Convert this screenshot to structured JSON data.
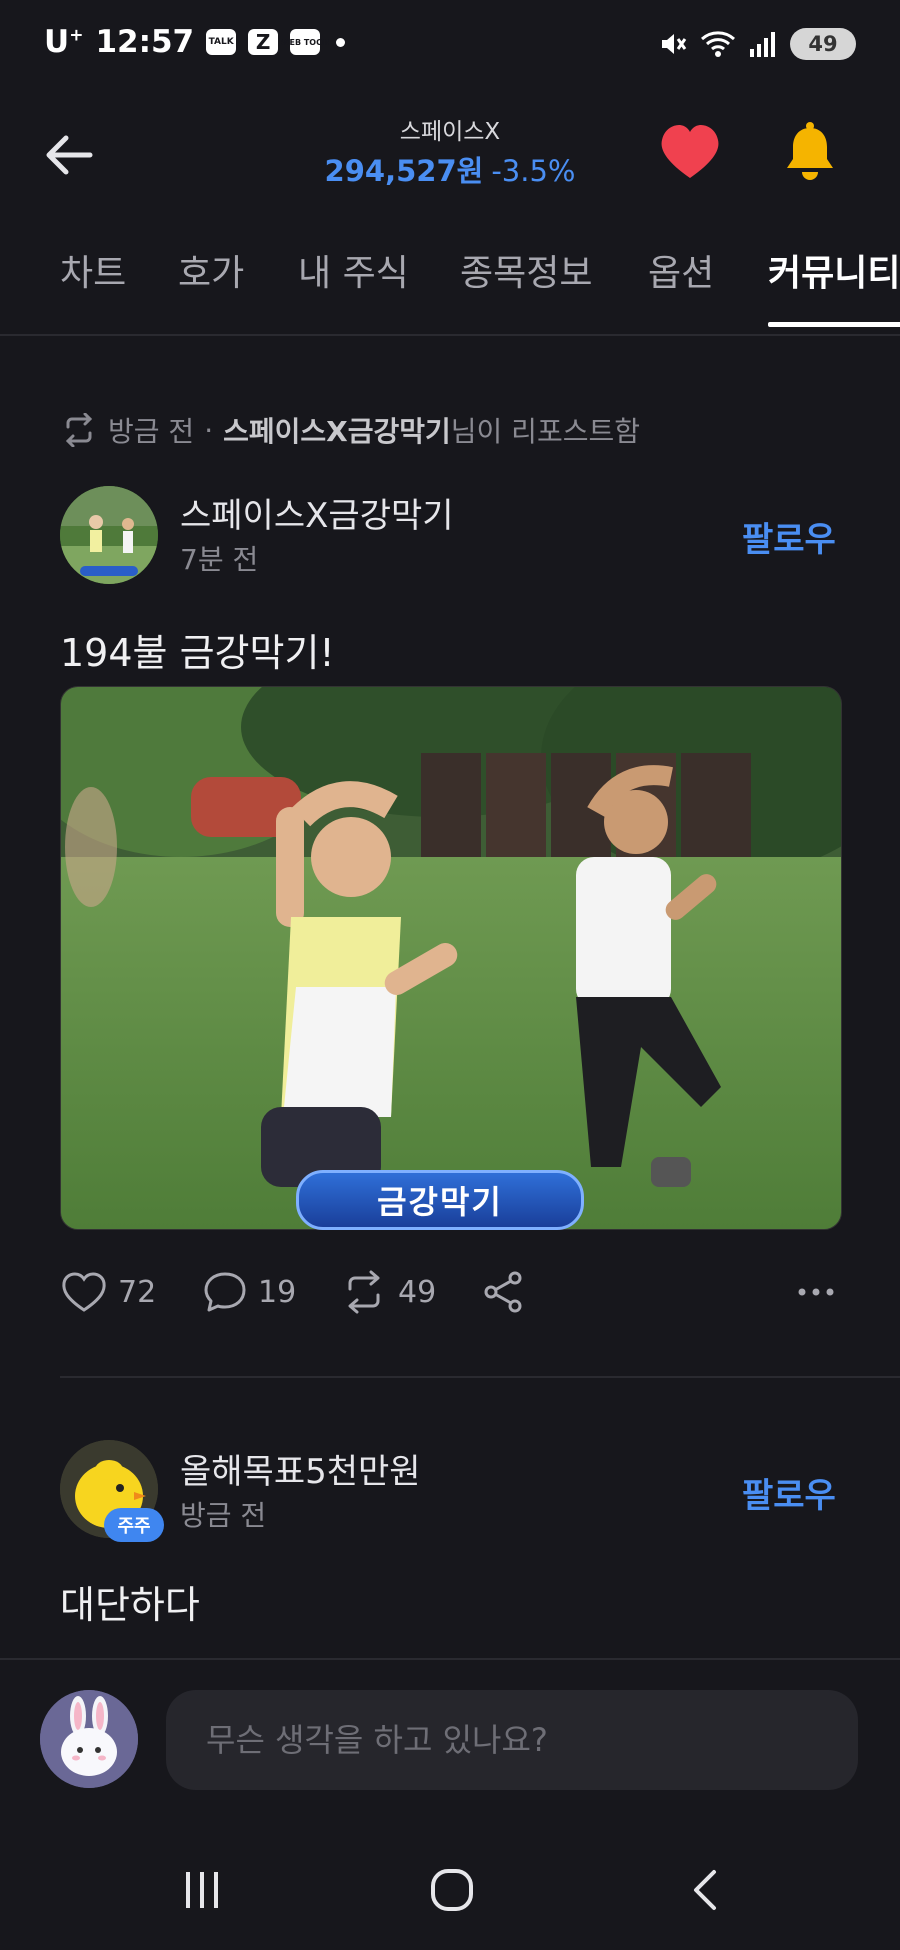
{
  "status_bar": {
    "carrier": "U",
    "carrier_sup": "+",
    "time": "12:57",
    "apps": [
      "TALK",
      "Z",
      "WEB TOON"
    ],
    "battery": "49"
  },
  "header": {
    "stock_name": "스페이스X",
    "price": "294,527원",
    "change_pct": "-3.5%",
    "heart_color": "#f0414f",
    "bell_color": "#f5b400",
    "accent_color": "#4a8ef2"
  },
  "tabs": [
    {
      "label": "차트",
      "active": false
    },
    {
      "label": "호가",
      "active": false
    },
    {
      "label": "내 주식",
      "active": false
    },
    {
      "label": "종목정보",
      "active": false
    },
    {
      "label": "옵션",
      "active": false
    },
    {
      "label": "커뮤니티",
      "active": true
    }
  ],
  "repost": {
    "time": "방금 전",
    "separator": "·",
    "user": "스페이스X금강막기",
    "suffix": "님이 리포스트함"
  },
  "post": {
    "author": "스페이스X금강막기",
    "time": "7분 전",
    "follow_label": "팔로우",
    "text": "194불 금강막기!",
    "image_caption": "금강막기",
    "likes": "72",
    "comments": "19",
    "reposts": "49"
  },
  "comment": {
    "author": "올해목표5천만원",
    "badge": "주주",
    "time": "방금 전",
    "follow_label": "팔로우",
    "text": "대단하다"
  },
  "composer": {
    "placeholder": "무슨 생각을 하고 있나요?"
  }
}
